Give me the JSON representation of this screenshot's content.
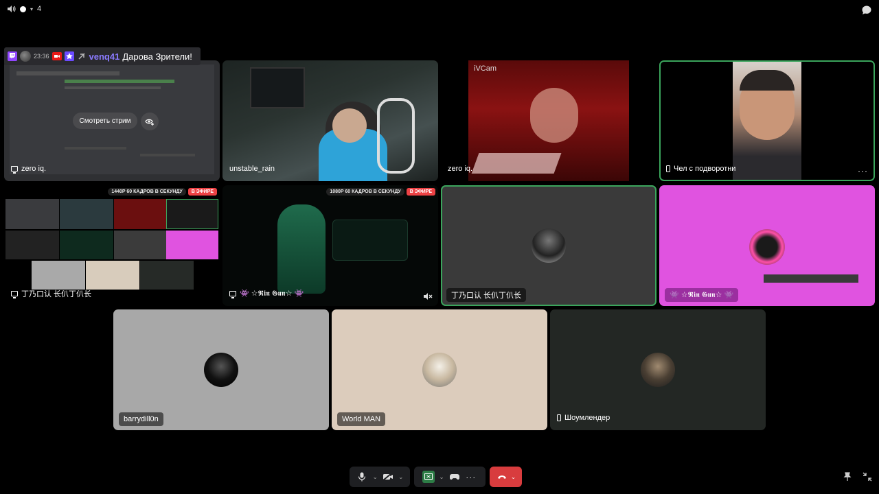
{
  "topbar": {
    "viewer_count": "4"
  },
  "twitch_chat": {
    "time": "23:36",
    "username": "venq41",
    "message": "Дарова Зрители!"
  },
  "tiles": {
    "stream_preview": {
      "label": "zero iq.",
      "watch_button": "Смотреть стрим"
    },
    "unstable_rain": {
      "label": "unstable_rain"
    },
    "ivcam": {
      "label": "zero iq.",
      "overlay_text": "iVCam"
    },
    "chel": {
      "label": "Чел с подворотни"
    },
    "screen_grid": {
      "label": "丁乃口认 长仈丁仈长",
      "quality": "1440P 60 КАДРОВ В СЕКУНДУ",
      "live": "В ЭФИРЕ"
    },
    "rin_stream": {
      "label": "👾 ☆𝕽𝖎𝖓 𝕲𝖚𝖓☆ 👾",
      "quality": "1080P 60 КАДРОВ В СЕКУНДУ",
      "live": "В ЭФИРЕ"
    },
    "user_gray": {
      "label": "丁乃口认 长仈丁仈长"
    },
    "user_pink": {
      "label": "👾 ☆𝕽𝖎𝖓 𝕲𝖚𝖓☆ 👾"
    },
    "barry": {
      "label": "barrydill0n"
    },
    "world_man": {
      "label": "World MAN"
    },
    "showman": {
      "label": "Шоумлендер"
    }
  },
  "colors": {
    "speaking": "#3ba55c",
    "pink_tile": "#e053e0",
    "end_call": "#d83c3e",
    "twitch_purple": "#9146ff"
  }
}
